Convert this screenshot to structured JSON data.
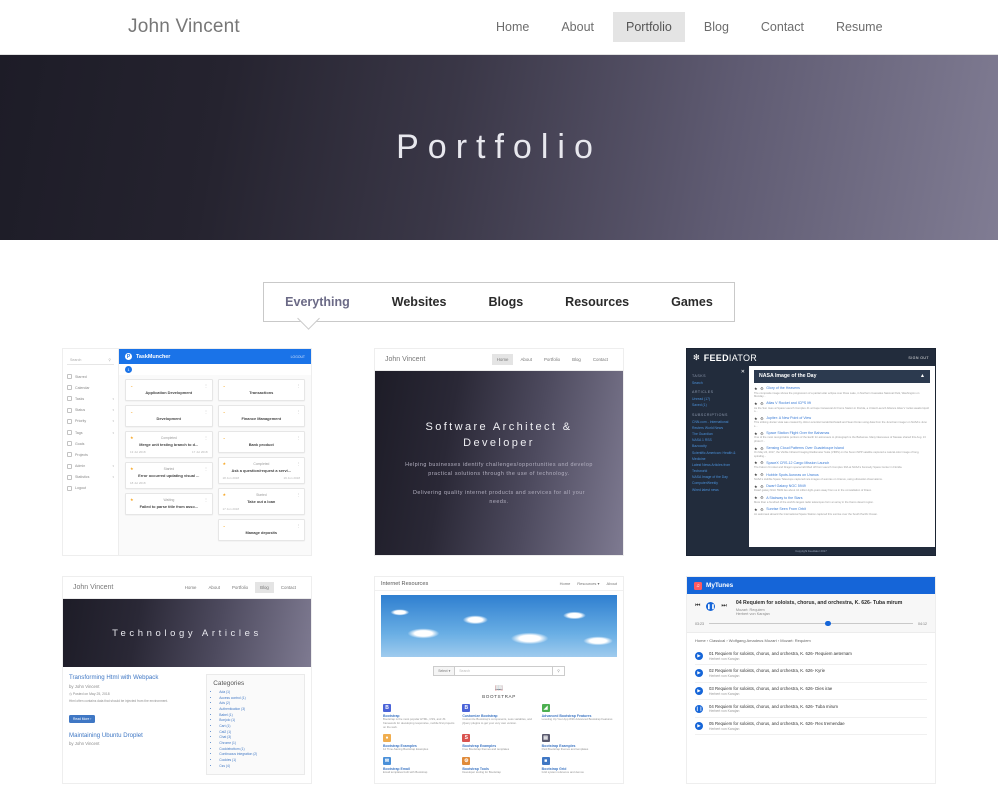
{
  "header": {
    "brand": "John Vincent",
    "nav": [
      {
        "label": "Home",
        "active": false
      },
      {
        "label": "About",
        "active": false
      },
      {
        "label": "Portfolio",
        "active": true
      },
      {
        "label": "Blog",
        "active": false
      },
      {
        "label": "Contact",
        "active": false
      },
      {
        "label": "Resume",
        "active": false
      }
    ]
  },
  "hero": {
    "title": "Portfolio"
  },
  "filters": [
    {
      "label": "Everything",
      "active": true
    },
    {
      "label": "Websites",
      "active": false
    },
    {
      "label": "Blogs",
      "active": false
    },
    {
      "label": "Resources",
      "active": false
    },
    {
      "label": "Games",
      "active": false
    }
  ],
  "projects": {
    "taskmuncher": {
      "app_title": "TaskMuncher",
      "logo_letter": "P",
      "logout": "LOGOUT",
      "badge": "1",
      "search_placeholder": "Search",
      "menu": [
        {
          "label": "Starred",
          "caret": false
        },
        {
          "label": "Calendar",
          "caret": false
        },
        {
          "label": "Tasks",
          "caret": true
        },
        {
          "label": "Status",
          "caret": true
        },
        {
          "label": "Priority",
          "caret": true
        },
        {
          "label": "Tags",
          "caret": true
        },
        {
          "label": "Goals",
          "caret": false
        },
        {
          "label": "Projects",
          "caret": false
        },
        {
          "label": "Admin",
          "caret": true
        },
        {
          "label": "Statistics",
          "caret": true
        },
        {
          "label": "Logout",
          "caret": false
        }
      ],
      "column_left": [
        {
          "status": "",
          "title": "Application Development",
          "starred": false,
          "start": "",
          "end": ""
        },
        {
          "status": "",
          "title": "Development",
          "starred": false,
          "start": "",
          "end": ""
        },
        {
          "status": "Completed",
          "title": "Merge unit testing branch to d...",
          "starred": true,
          "start": "13 Jul 2018",
          "end": "17 Jul 2018"
        },
        {
          "status": "Started",
          "title": "Error occurred updating visual ...",
          "starred": true,
          "start": "18 Jul 2018",
          "end": ""
        },
        {
          "status": "Waiting",
          "title": "Failed to parse title from asso...",
          "starred": true,
          "start": "",
          "end": ""
        }
      ],
      "column_right": [
        {
          "status": "",
          "title": "Transactions",
          "starred": false,
          "start": "",
          "end": ""
        },
        {
          "status": "",
          "title": "Finance Management",
          "starred": false,
          "start": "",
          "end": ""
        },
        {
          "status": "",
          "title": "Bank product",
          "starred": false,
          "start": "",
          "end": ""
        },
        {
          "status": "Completed",
          "title": "Ask a question/request a servi...",
          "starred": true,
          "start": "18 Jun 2018",
          "end": "19 Jun 2018"
        },
        {
          "status": "Started",
          "title": "Take out a loan",
          "starred": true,
          "start": "17 Jun 2018",
          "end": ""
        },
        {
          "status": "",
          "title": "Manage deposits",
          "starred": false,
          "start": "",
          "end": ""
        }
      ]
    },
    "homepage": {
      "brand": "John Vincent",
      "nav": [
        {
          "label": "Home",
          "active": true
        },
        {
          "label": "About",
          "active": false
        },
        {
          "label": "Portfolio",
          "active": false
        },
        {
          "label": "Blog",
          "active": false
        },
        {
          "label": "Contact",
          "active": false
        }
      ],
      "headline": "Software Architect & Developer",
      "paragraph_1": "Helping businesses identify challenges/opportunities and develop practical solutions through the use of technology.",
      "paragraph_2": "Delivering quality internet products and services for all your needs."
    },
    "feediator": {
      "name_bold": "FEED",
      "name_light": "IATOR",
      "sign_out": "SIGN OUT",
      "sections": [
        {
          "title": "TASKS",
          "links": [
            "Search"
          ]
        },
        {
          "title": "ARTICLES",
          "links": [
            "Unread (17)",
            "Saved (1)"
          ]
        },
        {
          "title": "SUBSCRIPTIONS",
          "links": [
            "CNN.com - International",
            "Reuters World News",
            "The Guardian",
            "NASA 1 RSS",
            "Bazoocity",
            "Scientific American: Health & Medicine",
            "Latest News Articles from Techworld",
            "NASA Image of the Day",
            "ComputerWeekly",
            "Wired latest news"
          ]
        }
      ],
      "active_feed": "NASA Image of the Day",
      "articles": [
        {
          "title": "Glory of the Heavens",
          "summary": "The composite image shows the progression of a partial solar eclipse over Ross Lake, in Northern Cascades National Park, Washington on Monday..."
        },
        {
          "title": "Atlas V Rocket and ICPS lift",
          "summary": "As the Sun rises at Space Launch Complex 41 at Cape Canaveral Air Force Station in Florida, a United Launch Alliance Atlas V rocket awaits liquid o..."
        },
        {
          "title": "Jupiter: A New Point of View",
          "summary": "This striking Jovian vista was created by citizen scientist Gerald Eichstadt and Sean Doran using data from the JunoCam imager on NASA's Juno s..."
        },
        {
          "title": "Space Station Flight Over the Bahamas",
          "summary": "One of the most recognizable portions of the Earth for astronauts to photograph is the Bahamas. Many likenesses of Nassau shared this Aug. 13 photo fr..."
        },
        {
          "title": "Sensing Cloud Patterns Over Guadeloupe Island",
          "summary": "On May 24, 2017, the Visible Infrared Imaging Radiometer Suite (VIIRS) on the Suomi NPP satellite captured a natural-color image of long, spiraling..."
        },
        {
          "title": "SpaceX CRS-12 Cargo Mission Launch",
          "summary": "The Falcon 9 rocket and Dragon spacecraft lifted off from Launch Complex 39A at NASA's Kennedy Space Center in Florida."
        },
        {
          "title": "Hubble Spots Auroras on Uranus",
          "summary": "NASA's Hubble Space Telescope captured rare images of auroras on Uranus, using ultraviolet observations."
        },
        {
          "title": "Dwarf Galaxy NGC 5949",
          "summary": "Dwarf galaxy NGC 5949 lies about 44 million light-years away from us in the constellation of Draco."
        },
        {
          "title": "A Stairway to the Stars",
          "summary": "More than a hundred of the world's largest radio telescopes form an array in the Karoo desert region."
        },
        {
          "title": "Sunrise Seen From Orbit",
          "summary": "An astronaut aboard the International Space Station captured this sunrise over the South Pacific Ocean."
        }
      ],
      "footer": "Copyright Feediator 2017"
    },
    "blog": {
      "brand": "John Vincent",
      "nav": [
        {
          "label": "Home",
          "active": false
        },
        {
          "label": "About",
          "active": false
        },
        {
          "label": "Portfolio",
          "active": false
        },
        {
          "label": "Blog",
          "active": true
        },
        {
          "label": "Contact",
          "active": false
        }
      ],
      "hero_title": "Technology Articles",
      "posts": [
        {
          "title": "Transforming Html with Webpack",
          "by": "by John Vincent",
          "date": "Posted on May 25, 2018",
          "excerpt": "Html often contains data that should be injected from the environment.",
          "button": "Read More"
        },
        {
          "title": "Maintaining Ubuntu Droplet",
          "by": "by John Vincent",
          "date": "",
          "excerpt": "",
          "button": ""
        }
      ],
      "sidebar_title": "Categories",
      "categories": [
        "Ada (1)",
        "Access control (1)",
        "Ads (2)",
        "Authentication (3)",
        "Babel (1)",
        "Bonjolo (1)",
        "Cart (1)",
        "Cat2 (1)",
        "Chat (3)",
        "Chrome (1)",
        "Cookiebottom (1)",
        "Continuous integration (2)",
        "Cookies (1)",
        "Css (4)"
      ]
    },
    "internet_resources": {
      "brand": "Internet Resources",
      "nav": [
        "Home",
        "Resources",
        "About"
      ],
      "select_label": "Select",
      "search_placeholder": "Search",
      "section_title": "BOOTSTRAP",
      "cards": [
        {
          "icon": "B",
          "color": "#4a63d8",
          "title": "Bootstrap",
          "desc": "Bootstrap is the most popular HTML, CSS, and JS framework for developing responsive, mobile first projects on the web."
        },
        {
          "icon": "B",
          "color": "#4a63d8",
          "title": "Customize Bootstrap",
          "desc": "Customize Bootstrap's components, Less variables, and jQuery plugins to get your very own version."
        },
        {
          "icon": "◢",
          "color": "#4caf50",
          "title": "Advanced Bootstrap Features",
          "desc": "Leveling Up Your App With Advanced Bootstrap Features"
        },
        {
          "icon": "●",
          "color": "#f0ad4e",
          "title": "Bootstrap Examples",
          "desc": "12 Time-Saving Bootstrap Examples"
        },
        {
          "icon": "S",
          "color": "#d9534f",
          "title": "Bootstrap Examples",
          "desc": "Free Bootstrap themes and templates"
        },
        {
          "icon": "▤",
          "color": "#5a5a6e",
          "title": "Bootstrap Examples",
          "desc": "Paid Bootstrap themes and templates"
        },
        {
          "icon": "✉",
          "color": "#4a90d9",
          "title": "Bootstrap Email",
          "desc": "Email templates built with Bootstrap"
        },
        {
          "icon": "⚙",
          "color": "#e08b3a",
          "title": "Bootstrap Tools",
          "desc": "Developer tooling for Bootstrap"
        },
        {
          "icon": "■",
          "color": "#3f77c4",
          "title": "Bootstrap Grid",
          "desc": "Grid system reference and demos"
        }
      ]
    },
    "mytunes": {
      "app_title": "MyTunes",
      "now_playing": "04 Requiem for soloists, chorus, and orchestra, K. 626- Tuba mirum",
      "album": "Mozart: Requiem",
      "artist": "Herbert von Karajan",
      "elapsed": "03:23",
      "duration": "04:12",
      "breadcrumb": "Home › Classical › Wolfgang Amadeus Mozart › Mozart: Requiem",
      "tracks": [
        {
          "title": "01 Requiem for soloists, chorus, and orchestra, K. 626- Requiem aeternam",
          "artist": "Herbert von Karajan",
          "playing": false
        },
        {
          "title": "02 Requiem for soloists, chorus, and orchestra, K. 626- Kyrie",
          "artist": "Herbert von Karajan",
          "playing": false
        },
        {
          "title": "03 Requiem for soloists, chorus, and orchestra, K. 626- Dies irae",
          "artist": "Herbert von Karajan",
          "playing": false
        },
        {
          "title": "04 Requiem for soloists, chorus, and orchestra, K. 626- Tuba mirum",
          "artist": "Herbert von Karajan",
          "playing": true
        },
        {
          "title": "05 Requiem for soloists, chorus, and orchestra, K. 626- Rex tremendae",
          "artist": "Herbert von Karajan",
          "playing": false
        }
      ]
    }
  }
}
